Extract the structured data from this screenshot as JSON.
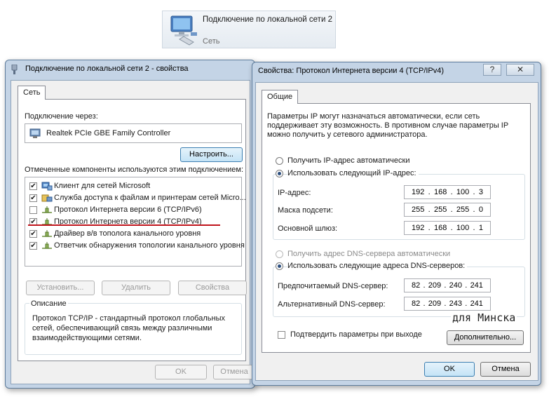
{
  "connection_tile": {
    "name": "Подключение по локальной сети 2",
    "status": "Сеть"
  },
  "left_window": {
    "title": "Подключение по локальной сети 2 - свойства",
    "tab": "Сеть",
    "connect_using_label": "Подключение через:",
    "adapter": "Realtek PCIe GBE Family Controller",
    "configure_button": "Настроить...",
    "components_label": "Отмеченные компоненты используются этим подключением:",
    "components": [
      {
        "label": "Клиент для сетей Microsoft",
        "checked": true,
        "icon": "network-client-icon"
      },
      {
        "label": "Служба доступа к файлам и принтерам сетей Micro...",
        "checked": true,
        "icon": "file-printer-service-icon"
      },
      {
        "label": "Протокол Интернета версии 6 (TCP/IPv6)",
        "checked": false,
        "icon": "protocol-icon"
      },
      {
        "label": "Протокол Интернета версии 4 (TCP/IPv4)",
        "checked": true,
        "icon": "protocol-icon"
      },
      {
        "label": "Драйвер в/в тополога канального уровня",
        "checked": true,
        "icon": "protocol-icon"
      },
      {
        "label": "Ответчик обнаружения топологии канального уровня",
        "checked": true,
        "icon": "protocol-icon"
      }
    ],
    "install_button": "Установить...",
    "uninstall_button": "Удалить",
    "properties_button": "Свойства",
    "description_label": "Описание",
    "description_text": "Протокол TCP/IP - стандартный протокол глобальных сетей, обеспечивающий связь между различными взаимодействующими сетями.",
    "ok_button": "OK",
    "cancel_button": "Отмена"
  },
  "right_window": {
    "title": "Свойства: Протокол Интернета версии 4 (TCP/IPv4)",
    "help_glyph": "?",
    "close_glyph": "✕",
    "tab": "Общие",
    "intro_text": "Параметры IP могут назначаться автоматически, если сеть поддерживает эту возможность. В противном случае параметры IP можно получить у сетевого администратора.",
    "auto_ip_label": "Получить IP-адрес автоматически",
    "manual_ip_label": "Использовать следующий IP-адрес:",
    "ip_label": "IP-адрес:",
    "ip_value": [
      "192",
      "168",
      "100",
      "3"
    ],
    "mask_label": "Маска подсети:",
    "mask_value": [
      "255",
      "255",
      "255",
      "0"
    ],
    "gateway_label": "Основной шлюз:",
    "gateway_value": [
      "192",
      "168",
      "100",
      "1"
    ],
    "auto_dns_label": "Получить адрес DNS-сервера автоматически",
    "manual_dns_label": "Использовать следующие адреса DNS-серверов:",
    "preferred_dns_label": "Предпочитаемый DNS-сервер:",
    "preferred_dns_value": [
      "82",
      "209",
      "240",
      "241"
    ],
    "alternate_dns_label": "Альтернативный DNS-сервер:",
    "alternate_dns_value": [
      "82",
      "209",
      "243",
      "241"
    ],
    "validate_label": "Подтвердить параметры при выходе",
    "advanced_button": "Дополнительно...",
    "ok_button": "OK",
    "cancel_button": "Отмена"
  },
  "annotation": {
    "text": "для Минска",
    "underline_color": "#c0141c"
  }
}
